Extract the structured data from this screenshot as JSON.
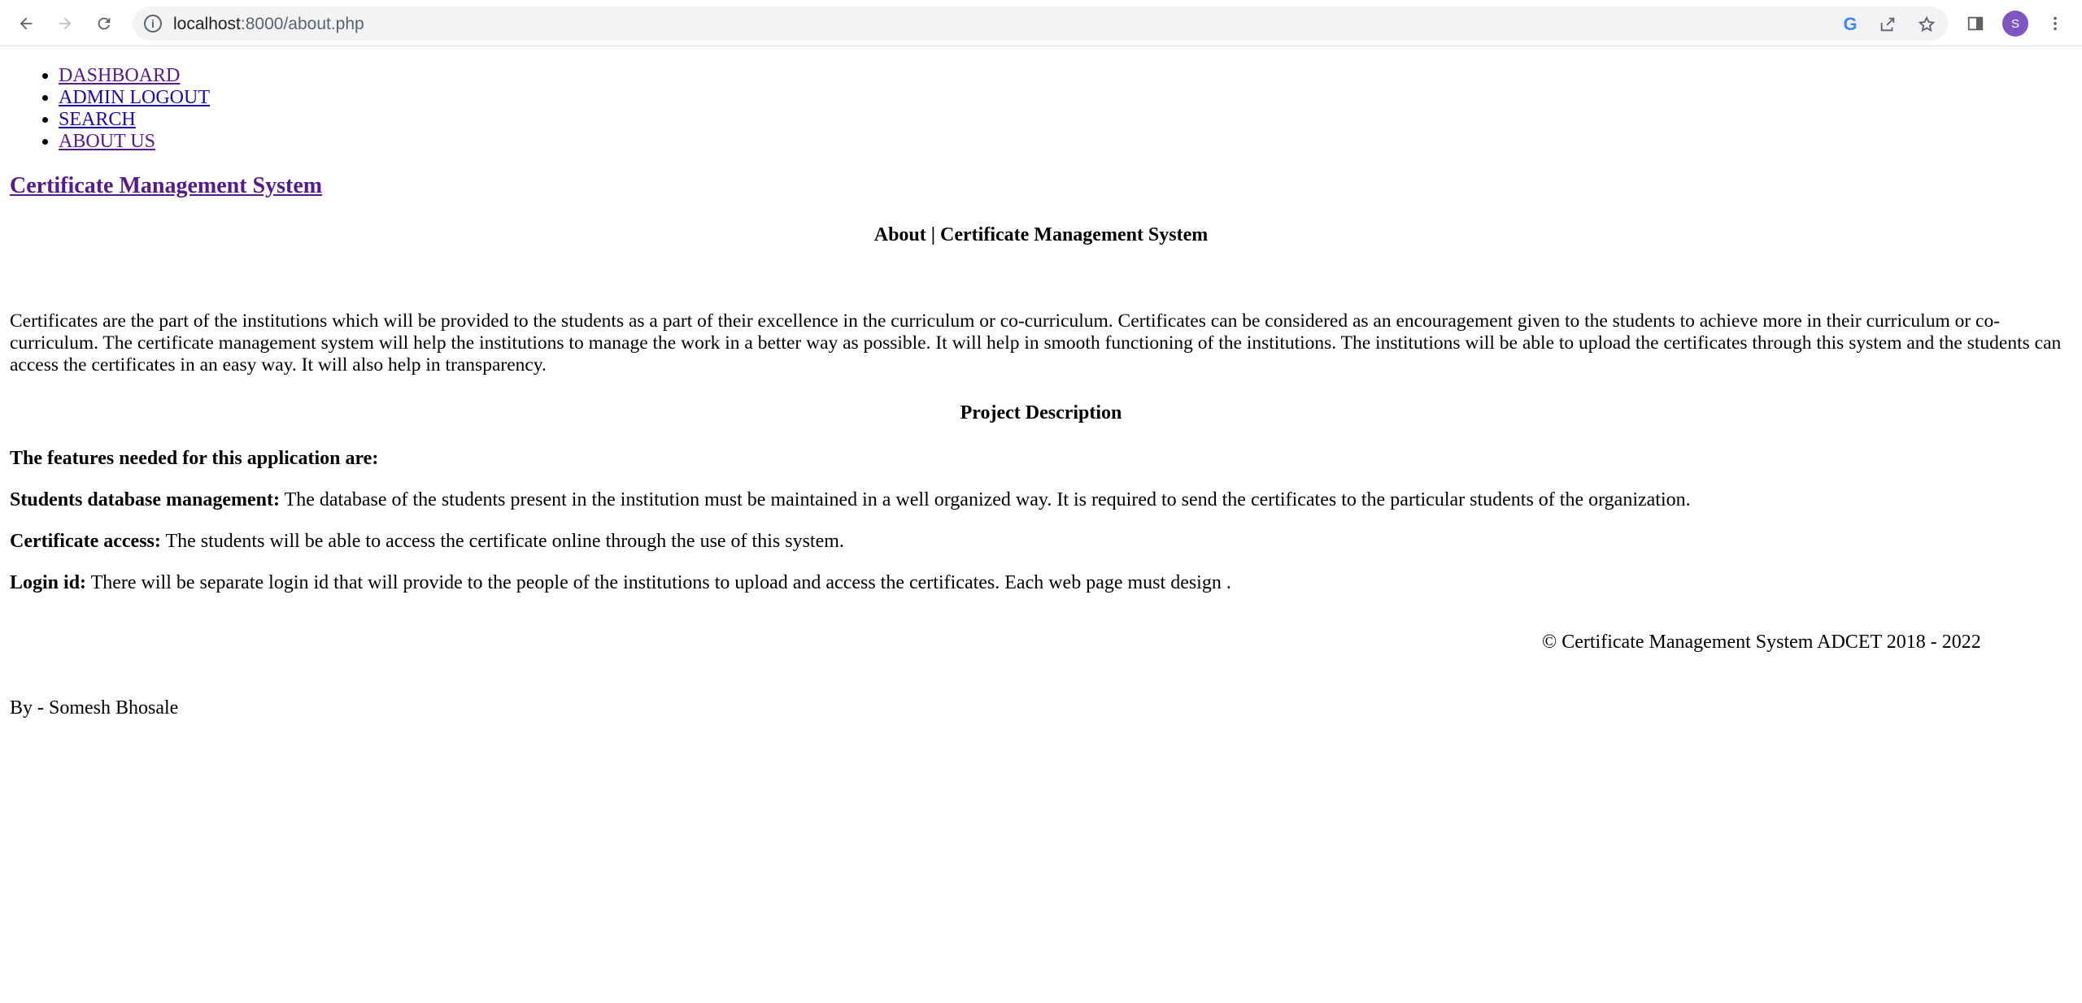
{
  "browser": {
    "url_host": "localhost",
    "url_path": ":8000/about.php",
    "avatar_letter": "S",
    "icons": [
      "back-icon",
      "forward-icon",
      "reload-icon",
      "info-icon",
      "google-icon",
      "share-icon",
      "bookmark-star-icon",
      "side-panel-icon",
      "menu-dots-icon"
    ]
  },
  "nav": {
    "items": [
      {
        "label": "DASHBOARD"
      },
      {
        "label": "ADMIN LOGOUT"
      },
      {
        "label": "SEARCH"
      },
      {
        "label": "ABOUT US"
      }
    ]
  },
  "site_title": "Certificate Management System",
  "about_heading": "About | Certificate Management System",
  "intro": "Certificates are the part of the institutions which will be provided to the students as a part of their excellence in the curriculum or co-curriculum. Certificates can be considered as an encouragement given to the students to achieve more in their curriculum or co-curriculum. The certificate management system will help the institutions to manage the work in a better way as possible. It will help in smooth functioning of the institutions. The institutions will be able to upload the certificates through this system and the students can access the certificates in an easy way. It will also help in transparency.",
  "project_heading": "Project Description",
  "features_heading": "The features needed for this application are:",
  "features": [
    {
      "title": "Students database management:",
      "text": " The database of the students present in the institution must be maintained in a well organized way. It is required to send the certificates to the particular students of the organization."
    },
    {
      "title": "Certificate access:",
      "text": " The students will be able to access the certificate online through the use of this system."
    },
    {
      "title": "Login id:",
      "text": " There will be separate login id that will provide to the people of the institutions to upload and access the certificates. Each web page must design ."
    }
  ],
  "copyright": "© Certificate Management System ADCET 2018 - 2022",
  "byline": "By - Somesh Bhosale",
  "colors": {
    "link": "#1a0dab",
    "visited": "#551a8b",
    "avatar": "#7e57c2"
  }
}
